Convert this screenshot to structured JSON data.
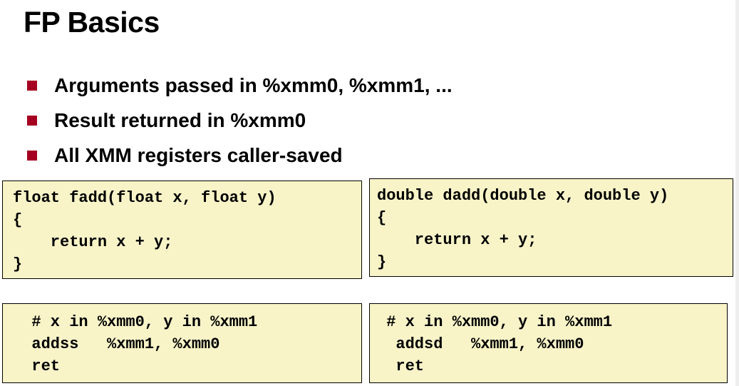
{
  "colors": {
    "bullet": "#a50021",
    "code_bg": "#f8f4c8",
    "border": "#000000"
  },
  "slide": {
    "title": "FP Basics",
    "bullets": [
      "Arguments passed in %xmm0, %xmm1, ...",
      "Result returned in %xmm0",
      "All XMM registers caller-saved"
    ]
  },
  "code": {
    "fadd": [
      "float fadd(float x, float y)",
      "{",
      "    return x + y;",
      "}"
    ],
    "dadd": [
      "double dadd(double x, double y)",
      "{",
      "    return x + y;",
      "}"
    ],
    "asm_fadd": [
      "  # x in %xmm0, y in %xmm1",
      "  addss   %xmm1, %xmm0",
      "  ret"
    ],
    "asm_dadd": [
      " # x in %xmm0, y in %xmm1",
      "  addsd   %xmm1, %xmm0",
      "  ret"
    ]
  }
}
